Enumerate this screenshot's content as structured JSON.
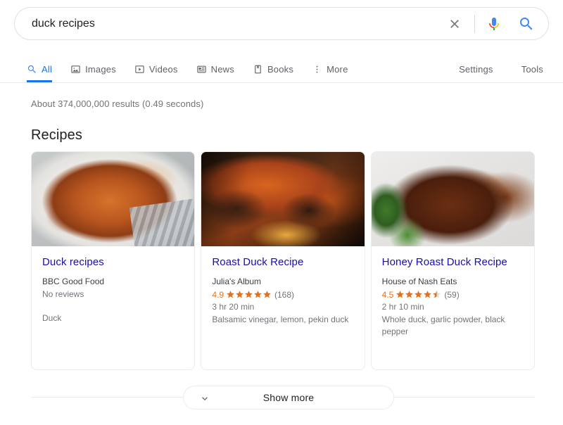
{
  "search": {
    "query": "duck recipes",
    "placeholder": "Search",
    "clear_icon": "close-icon",
    "mic_icon": "microphone-icon",
    "search_icon": "search-icon"
  },
  "nav": {
    "tabs": [
      {
        "label": "All",
        "icon": "search-icon",
        "active": true
      },
      {
        "label": "Images",
        "icon": "image-icon",
        "active": false
      },
      {
        "label": "Videos",
        "icon": "video-icon",
        "active": false
      },
      {
        "label": "News",
        "icon": "news-icon",
        "active": false
      },
      {
        "label": "Books",
        "icon": "book-icon",
        "active": false
      },
      {
        "label": "More",
        "icon": "more-vertical-icon",
        "active": false
      }
    ],
    "right": [
      {
        "label": "Settings"
      },
      {
        "label": "Tools"
      }
    ],
    "active_color": "#1a73e8"
  },
  "results": {
    "stats": "About 374,000,000 results (0.49 seconds)"
  },
  "recipes": {
    "section_title": "Recipes",
    "star_color": "#e7711b",
    "cards": [
      {
        "title": "Duck recipes",
        "site": "BBC Good Food",
        "rating": null,
        "rating_text": "No reviews",
        "review_count": null,
        "time": "",
        "ingredients": "Duck",
        "image_alt": "roast-duck-in-white-dish"
      },
      {
        "title": "Roast Duck Recipe",
        "site": "Julia's Album",
        "rating": "4.9",
        "rating_text": null,
        "review_count": "(168)",
        "time": "3 hr 20 min",
        "ingredients": "Balsamic vinegar, lemon, pekin duck",
        "image_alt": "caramelized-roast-duck-closeup"
      },
      {
        "title": "Honey Roast Duck Recipe",
        "site": "House of Nash Eats",
        "rating": "4.5",
        "rating_text": null,
        "review_count": "(59)",
        "time": "2 hr 10 min",
        "ingredients": "Whole duck, garlic powder, black pepper",
        "image_alt": "honey-roast-duck-on-greens"
      }
    ]
  },
  "show_more": {
    "label": "Show more",
    "icon": "chevron-down-icon"
  }
}
